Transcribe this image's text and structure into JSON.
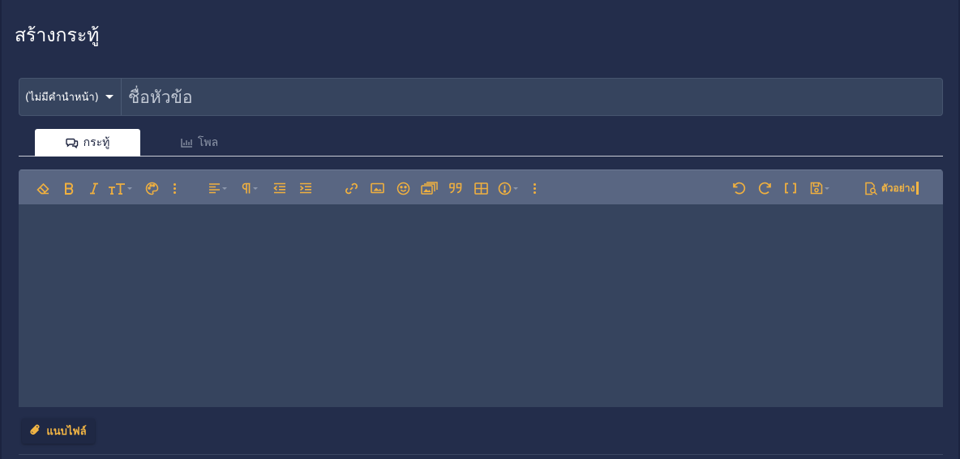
{
  "page": {
    "title": "สร้างกระทู้"
  },
  "title_row": {
    "prefix_value": "(ไม่มีคำนำหน้า)",
    "title_placeholder": "ชื่อหัวข้อ"
  },
  "tabs": [
    {
      "label": "กระทู้",
      "icon": "comments-icon",
      "active": true
    },
    {
      "label": "โพล",
      "icon": "chart-bar-icon",
      "active": false
    }
  ],
  "toolbar": {
    "left_tools": [
      "eraser-icon",
      "bold-icon",
      "italic-icon",
      "text-size-icon",
      "palette-icon",
      "more-icon",
      "align-icon",
      "paragraph-icon",
      "outdent-icon",
      "indent-icon",
      "link-icon",
      "image-icon",
      "emoji-icon",
      "media-icon",
      "quote-icon",
      "table-icon",
      "alert-icon",
      "more-icon"
    ],
    "right_tools": [
      "undo-icon",
      "redo-icon",
      "code-brackets-icon",
      "save-draft-icon"
    ],
    "preview_label": "ตัวอย่าง"
  },
  "attach": {
    "label": "แนบไฟล์",
    "icon": "paperclip-icon"
  },
  "colors": {
    "background": "#232d4b",
    "panel": "#36445e",
    "toolbar": "#596682",
    "accent": "#f2b544"
  }
}
